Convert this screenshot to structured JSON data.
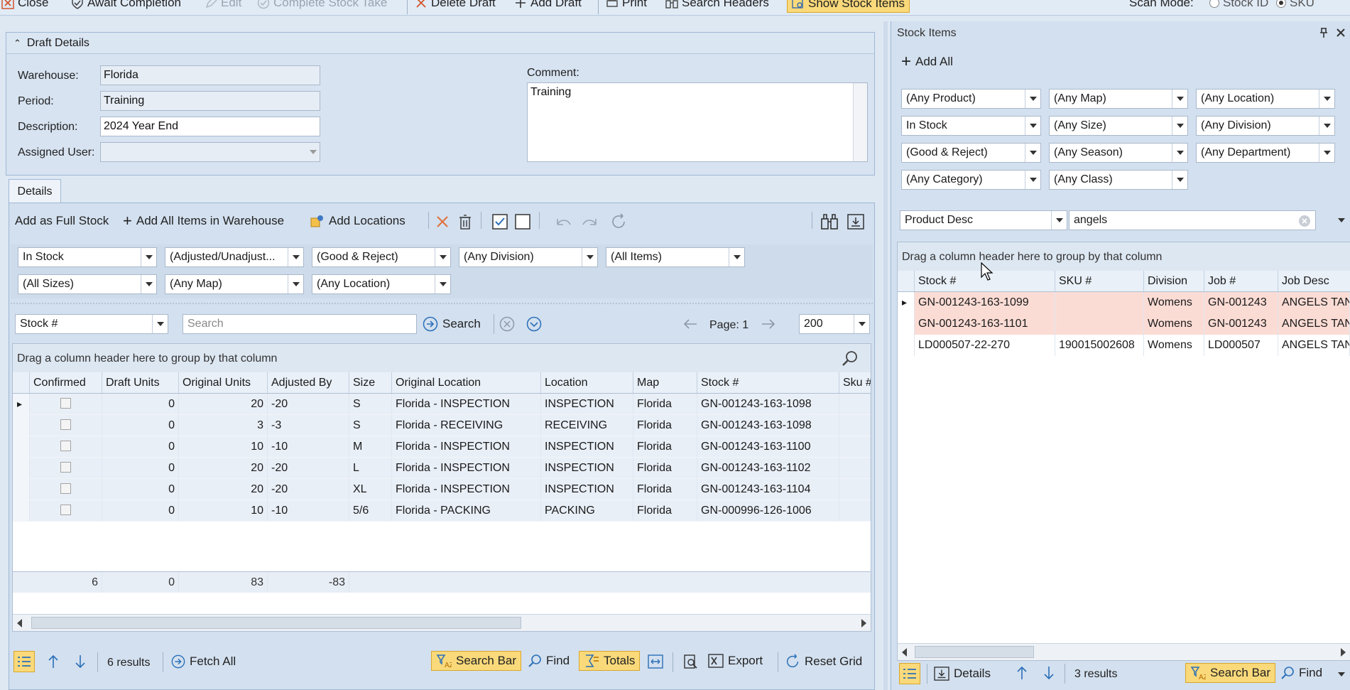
{
  "toolbar": {
    "close": "Close",
    "await": "Await Completion",
    "edit": "Edit",
    "complete": "Complete Stock Take",
    "delete_draft": "Delete Draft",
    "add_draft": "Add Draft",
    "print": "Print",
    "search_headers": "Search Headers",
    "show_stock_items": "Show Stock Items",
    "scan_mode_label": "Scan Mode:",
    "scan_stock_id": "Stock ID",
    "scan_sku": "SKU"
  },
  "draft": {
    "title": "Draft Details",
    "warehouse_label": "Warehouse:",
    "warehouse": "Florida",
    "period_label": "Period:",
    "period": "Training",
    "description_label": "Description:",
    "description": "2024 Year End",
    "assigned_label": "Assigned User:",
    "assigned": "",
    "comment_label": "Comment:",
    "comment": "Training"
  },
  "details": {
    "tab": "Details",
    "add_full": "Add as Full Stock",
    "add_all": "Add All Items in Warehouse",
    "add_locations": "Add Locations",
    "filters": [
      "In Stock",
      "(Adjusted/Unadjust...",
      "(Good & Reject)",
      "(Any Division)",
      "(All Items)",
      "(All Sizes)",
      "(Any Map)",
      "(Any Location)"
    ],
    "search_field": "Stock #",
    "search_placeholder": "Search",
    "search_btn": "Search",
    "page_label": "Page: 1",
    "page_size": "200",
    "group_hint": "Drag a column header here to group by that column",
    "columns": [
      "Confirmed",
      "Draft Units",
      "Original Units",
      "Adjusted By",
      "Size",
      "Original Location",
      "Location",
      "Map",
      "Stock #",
      "Sku #"
    ],
    "rows": [
      {
        "draft": "0",
        "orig": "20",
        "adj": "-20",
        "size": "S",
        "oloc": "Florida - INSPECTION",
        "loc": "INSPECTION",
        "map": "Florida",
        "stock": "GN-001243-163-1098"
      },
      {
        "draft": "0",
        "orig": "3",
        "adj": "-3",
        "size": "S",
        "oloc": "Florida - RECEIVING",
        "loc": "RECEIVING",
        "map": "Florida",
        "stock": "GN-001243-163-1098"
      },
      {
        "draft": "0",
        "orig": "10",
        "adj": "-10",
        "size": "M",
        "oloc": "Florida - INSPECTION",
        "loc": "INSPECTION",
        "map": "Florida",
        "stock": "GN-001243-163-1100"
      },
      {
        "draft": "0",
        "orig": "20",
        "adj": "-20",
        "size": "L",
        "oloc": "Florida - INSPECTION",
        "loc": "INSPECTION",
        "map": "Florida",
        "stock": "GN-001243-163-1102"
      },
      {
        "draft": "0",
        "orig": "20",
        "adj": "-20",
        "size": "XL",
        "oloc": "Florida - INSPECTION",
        "loc": "INSPECTION",
        "map": "Florida",
        "stock": "GN-001243-163-1104"
      },
      {
        "draft": "0",
        "orig": "10",
        "adj": "-10",
        "size": "5/6",
        "oloc": "Florida - PACKING",
        "loc": "PACKING",
        "map": "Florida",
        "stock": "GN-000996-126-1006"
      }
    ],
    "totals": {
      "count": "6",
      "draft": "0",
      "orig": "83",
      "adj": "-83"
    },
    "results": "6 results",
    "fetch_all": "Fetch All",
    "search_bar": "Search Bar",
    "find": "Find",
    "totals_btn": "Totals",
    "export": "Export",
    "reset_grid": "Reset Grid"
  },
  "stock": {
    "title": "Stock Items",
    "add_all": "Add All",
    "filters": [
      "(Any Product)",
      "(Any Map)",
      "(Any Location)",
      "In Stock",
      "(Any Size)",
      "(Any Division)",
      "(Good & Reject)",
      "(Any Season)",
      "(Any Department)",
      "(Any Category)",
      "(Any Class)"
    ],
    "search_field": "Product Desc",
    "search_value": "angels",
    "group_hint": "Drag a column header here to group by that column",
    "columns": [
      "Stock #",
      "SKU #",
      "Division",
      "Job #",
      "Job Desc"
    ],
    "rows": [
      {
        "stock": "GN-001243-163-1099",
        "sku": "",
        "div": "Womens",
        "job": "GN-001243",
        "desc": "ANGELS TANK"
      },
      {
        "stock": "GN-001243-163-1101",
        "sku": "",
        "div": "Womens",
        "job": "GN-001243",
        "desc": "ANGELS TANK"
      },
      {
        "stock": "LD000507-22-270",
        "sku": "190015002608",
        "div": "Womens",
        "job": "LD000507",
        "desc": "ANGELS TANK"
      }
    ],
    "details_btn": "Details",
    "results": "3 results",
    "search_bar": "Search Bar",
    "find": "Find"
  }
}
